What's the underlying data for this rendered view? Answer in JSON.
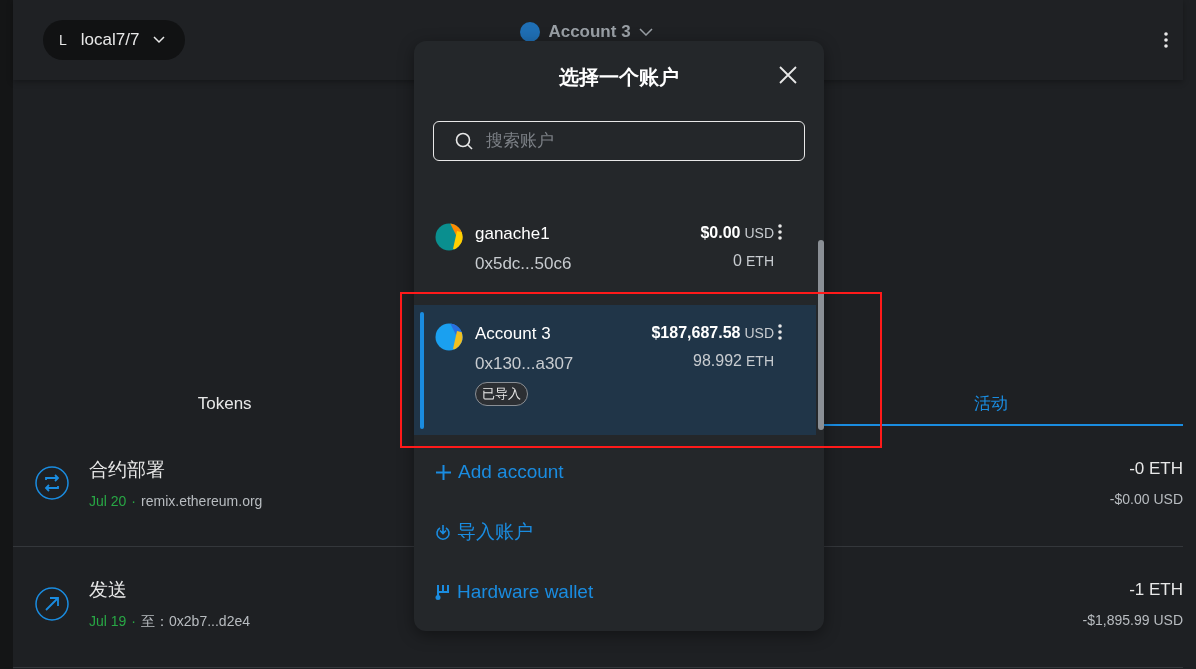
{
  "header": {
    "network": {
      "initial": "L",
      "name": "local7/7"
    },
    "account": {
      "name": "Account 3"
    }
  },
  "tabs": [
    {
      "label": "Tokens",
      "selected": false
    },
    {
      "label": "活动",
      "selected": true
    }
  ],
  "activity": [
    {
      "kind": "contract",
      "title": "合约部署",
      "date": "Jul 20",
      "separator": "·",
      "detail": "remix.ethereum.org",
      "amount": "-0 ETH",
      "fiat": "-$0.00 USD"
    },
    {
      "kind": "send",
      "title": "发送",
      "date": "Jul 19",
      "separator": "·",
      "detail": "至：0x2b7...d2e4",
      "amount": "-1 ETH",
      "fiat": "-$1,895.99 USD"
    }
  ],
  "modal": {
    "title": "选择一个账户",
    "search": {
      "placeholder": "搜索账户"
    },
    "accounts": [
      {
        "name": "ganache1",
        "address": "0x5dc...50c6",
        "fiat": "$0.00",
        "fiat_unit": "USD",
        "balance": "0",
        "unit": "ETH",
        "selected": false
      },
      {
        "name": "Account 3",
        "address": "0x130...a307",
        "fiat": "$187,687.58",
        "fiat_unit": "USD",
        "balance": "98.992",
        "unit": "ETH",
        "tag": "已导入",
        "selected": true
      }
    ],
    "actions": [
      {
        "kind": "add",
        "label": "Add account"
      },
      {
        "kind": "import",
        "label": "导入账户"
      },
      {
        "kind": "hardware",
        "label": "Hardware wallet"
      }
    ]
  }
}
